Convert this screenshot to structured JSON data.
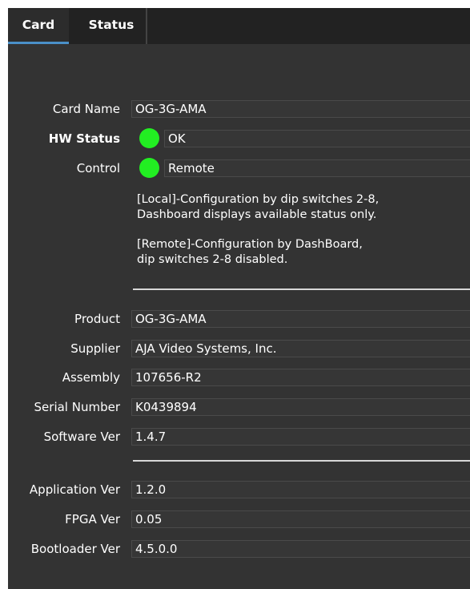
{
  "tabs": {
    "card": "Card",
    "status": "Status"
  },
  "fields": {
    "card_name": {
      "label": "Card Name",
      "value": "OG-3G-AMA"
    },
    "hw_status": {
      "label": "HW Status",
      "value": "OK",
      "indicator_color": "#22ee22"
    },
    "control": {
      "label": "Control",
      "value": "Remote",
      "indicator_color": "#22ee22"
    },
    "product": {
      "label": "Product",
      "value": "OG-3G-AMA"
    },
    "supplier": {
      "label": "Supplier",
      "value": "AJA Video Systems, Inc."
    },
    "assembly": {
      "label": "Assembly",
      "value": "107656-R2"
    },
    "serial_number": {
      "label": "Serial Number",
      "value": "K0439894"
    },
    "software_ver": {
      "label": "Software Ver",
      "value": "1.4.7"
    },
    "application_ver": {
      "label": "Application Ver",
      "value": "1.2.0"
    },
    "fpga_ver": {
      "label": "FPGA Ver",
      "value": "0.05"
    },
    "bootloader_ver": {
      "label": "Bootloader Ver",
      "value": "4.5.0.0"
    }
  },
  "notes": {
    "local_line1": "[Local]-Configuration by dip switches 2-8,",
    "local_line2": "Dashboard displays available status only.",
    "remote_line1": "[Remote]-Configuration by DashBoard,",
    "remote_line2": "dip switches 2-8 disabled."
  },
  "colors": {
    "panel_bg": "#333333",
    "tab_bar_bg": "#222222",
    "active_tab_underline": "#4a90c8",
    "indicator_ok": "#22ee22"
  }
}
